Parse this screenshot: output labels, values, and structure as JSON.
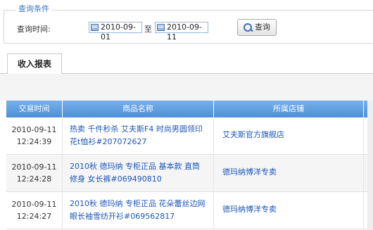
{
  "query": {
    "legend": "查询条件",
    "time_label": "查询时间:",
    "start_date": "2010-09-01",
    "to_label": "至",
    "end_date": "2010-09-11",
    "button_label": "查询"
  },
  "tabs": [
    {
      "label": "收入报表",
      "active": true
    }
  ],
  "table": {
    "columns": [
      "交易时间",
      "商品名称",
      "所属店铺"
    ],
    "rows": [
      {
        "date": "2010-09-11",
        "time": "12:24:39",
        "goods": "热卖 千件秒杀 艾夫斯F4 时尚男圆领印花t恤衫#207072627",
        "shop": "艾夫斯官方旗舰店"
      },
      {
        "date": "2010-09-11",
        "time": "12:24:28",
        "goods": "2010秋 德玛纳 专柜正品 基本款 直筒 修身 女长裤#069490810",
        "shop": "德玛纳博洋专卖"
      },
      {
        "date": "2010-09-11",
        "time": "12:24:27",
        "goods": "2010秋 德玛纳 专柜正品 花朵蕾丝边网眼长袖雪纺开衫#069562817",
        "shop": "德玛纳博洋专卖"
      }
    ]
  },
  "colors": {
    "header_blue": "#5a9ae0",
    "link_blue": "#1a56b8",
    "legend_blue": "#3a73c6"
  }
}
